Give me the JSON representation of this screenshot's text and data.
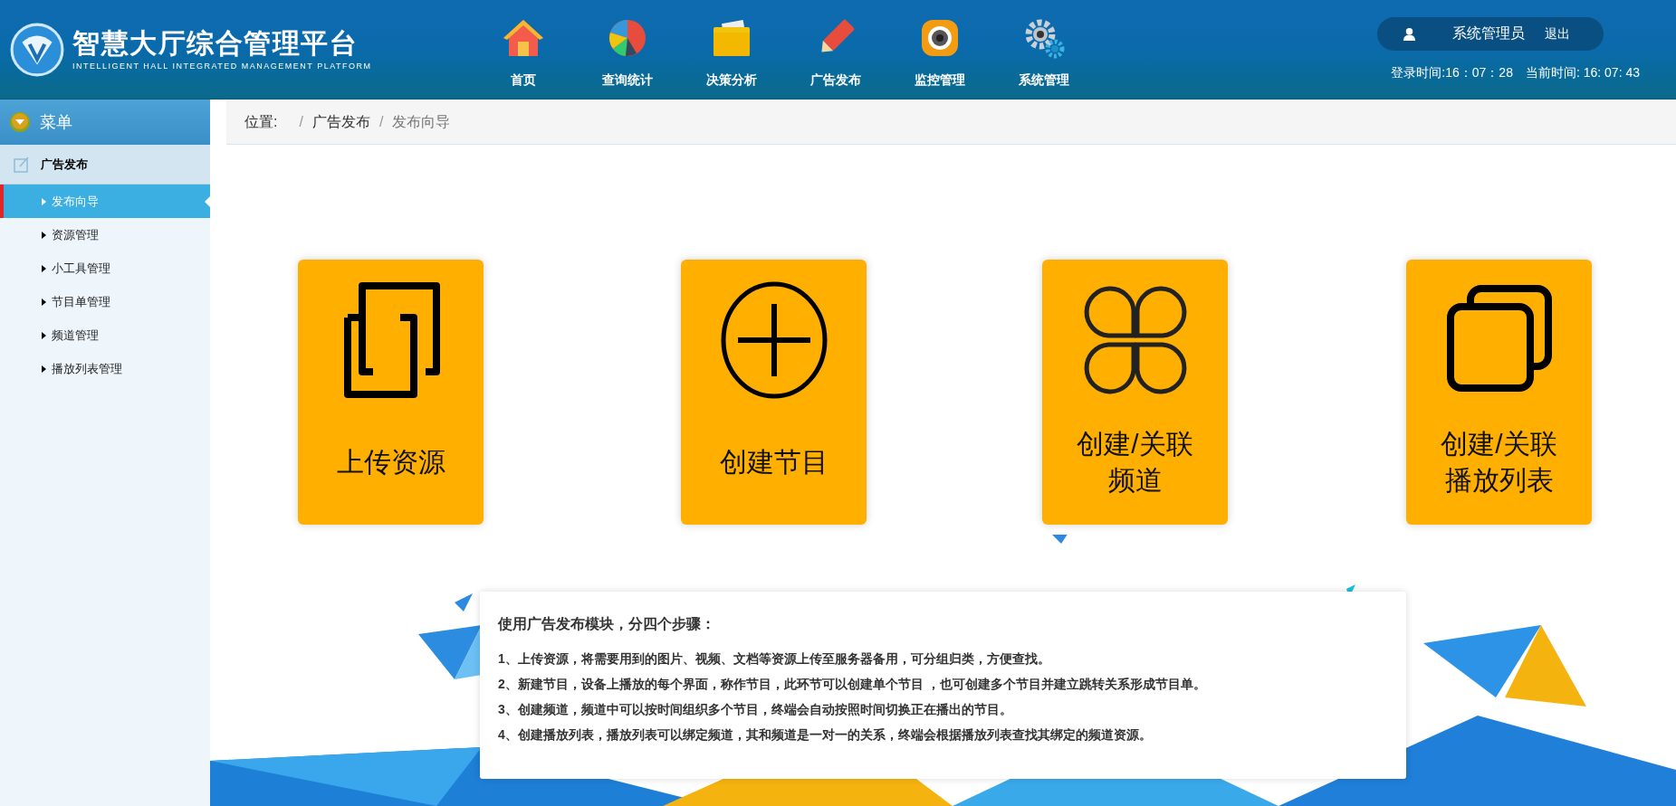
{
  "header": {
    "title": "智慧大厅综合管理平台",
    "subtitle": "INTELLIGENT HALL INTEGRATED MANAGEMENT PLATFORM",
    "nav": [
      {
        "label": "首页"
      },
      {
        "label": "查询统计"
      },
      {
        "label": "决策分析"
      },
      {
        "label": "广告发布"
      },
      {
        "label": "监控管理"
      },
      {
        "label": "系统管理"
      }
    ],
    "user": "系统管理员",
    "logout": "退出",
    "login_time": "登录时间:16：07：28",
    "current_time": "当前时间: 16: 07: 43"
  },
  "sidebar": {
    "title": "菜单",
    "section": "广告发布",
    "items": [
      {
        "label": "发布向导",
        "selected": true
      },
      {
        "label": "资源管理",
        "selected": false
      },
      {
        "label": "小工具管理",
        "selected": false
      },
      {
        "label": "节目单管理",
        "selected": false
      },
      {
        "label": "频道管理",
        "selected": false
      },
      {
        "label": "播放列表管理",
        "selected": false
      }
    ]
  },
  "breadcrumb": {
    "label": "位置:",
    "items": [
      {
        "separator": "/",
        "label": "广告发布"
      },
      {
        "separator": "/",
        "label": "发布向导"
      }
    ]
  },
  "cards": [
    {
      "lines": [
        "上传资源"
      ]
    },
    {
      "lines": [
        "创建节目"
      ]
    },
    {
      "lines": [
        "创建/关联",
        "频道"
      ]
    },
    {
      "lines": [
        "创建/关联",
        "播放列表"
      ]
    }
  ],
  "instructions": {
    "title": "使用广告发布模块，分四个步骤：",
    "steps": [
      "1、上传资源，将需要用到的图片、视频、文档等资源上传至服务器备用，可分组归类，方便查找。",
      "2、新建节目，设备上播放的每个界面，称作节目，此环节可以创建单个节目 ，也可创建多个节目并建立跳转关系形成节目单。",
      "3、创建频道，频道中可以按时间组织多个节目，终端会自动按照时间切换正在播出的节目。",
      "4、创建播放列表，播放列表可以绑定频道，其和频道是一对一的关系，终端会根据播放列表查找其绑定的频道资源。"
    ]
  }
}
